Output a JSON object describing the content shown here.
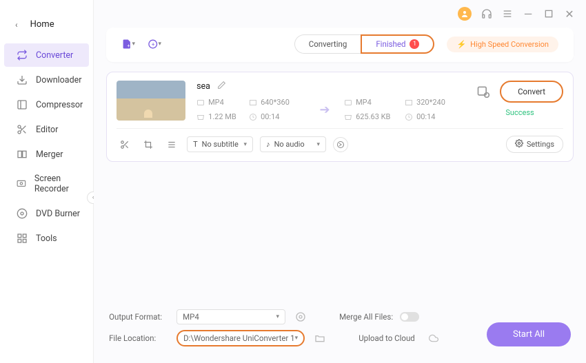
{
  "sidebar": {
    "home": "Home",
    "items": [
      {
        "label": "Converter"
      },
      {
        "label": "Downloader"
      },
      {
        "label": "Compressor"
      },
      {
        "label": "Editor"
      },
      {
        "label": "Merger"
      },
      {
        "label": "Screen Recorder"
      },
      {
        "label": "DVD Burner"
      },
      {
        "label": "Tools"
      }
    ]
  },
  "toolbar": {
    "tabs": {
      "converting": "Converting",
      "finished": "Finished",
      "badge": "1"
    },
    "high_speed": "High Speed Conversion"
  },
  "file": {
    "name": "sea",
    "src": {
      "format": "MP4",
      "resolution": "640*360",
      "size": "1.22 MB",
      "duration": "00:14"
    },
    "dst": {
      "format": "MP4",
      "resolution": "320*240",
      "size": "625.63 KB",
      "duration": "00:14"
    },
    "convert": "Convert",
    "status": "Success",
    "subtitle": "No subtitle",
    "audio": "No audio",
    "settings": "Settings"
  },
  "footer": {
    "output_label": "Output Format:",
    "output_value": "MP4",
    "location_label": "File Location:",
    "location_value": "D:\\Wondershare UniConverter 1",
    "merge_label": "Merge All Files:",
    "upload_label": "Upload to Cloud",
    "start_all": "Start All"
  }
}
